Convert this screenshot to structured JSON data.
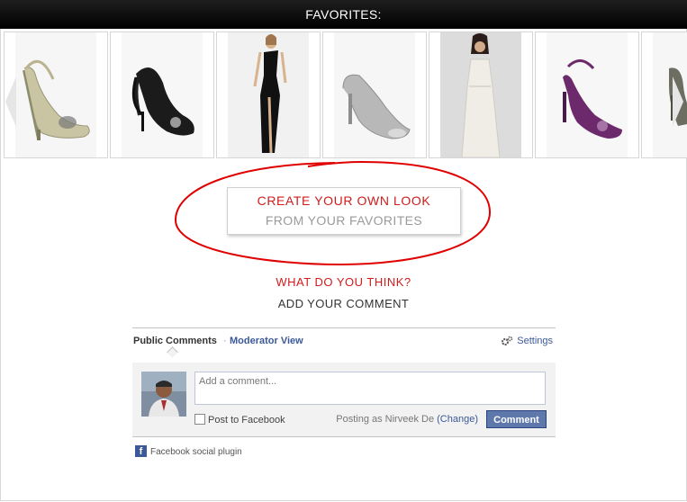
{
  "header": {
    "title": "FAVORITES:"
  },
  "favorites": [
    {
      "name": "sling-back-heel-metallic"
    },
    {
      "name": "black-sling-back-heel"
    },
    {
      "name": "black-one-shoulder-gown"
    },
    {
      "name": "silver-peep-toe-pump"
    },
    {
      "name": "white-lace-gown"
    },
    {
      "name": "purple-ankle-strap-heel"
    },
    {
      "name": "croc-print-heel"
    }
  ],
  "cta": {
    "line1": "CREATE YOUR OWN LOOK",
    "line2": "FROM YOUR FAVORITES",
    "annotation_color": "#e00000"
  },
  "prompt": {
    "question": "WHAT DO YOU THINK?",
    "add_comment": "ADD YOUR COMMENT"
  },
  "comments": {
    "tab_public": "Public Comments",
    "separator": "·",
    "tab_moderator": "Moderator View",
    "settings": "Settings",
    "input_placeholder": "Add a comment...",
    "post_to_facebook": "Post to Facebook",
    "posting_as_prefix": "Posting as Nirveek De",
    "change": "(Change)",
    "submit": "Comment",
    "plugin_label": "Facebook social plugin",
    "brand_color": "#3b5998"
  }
}
